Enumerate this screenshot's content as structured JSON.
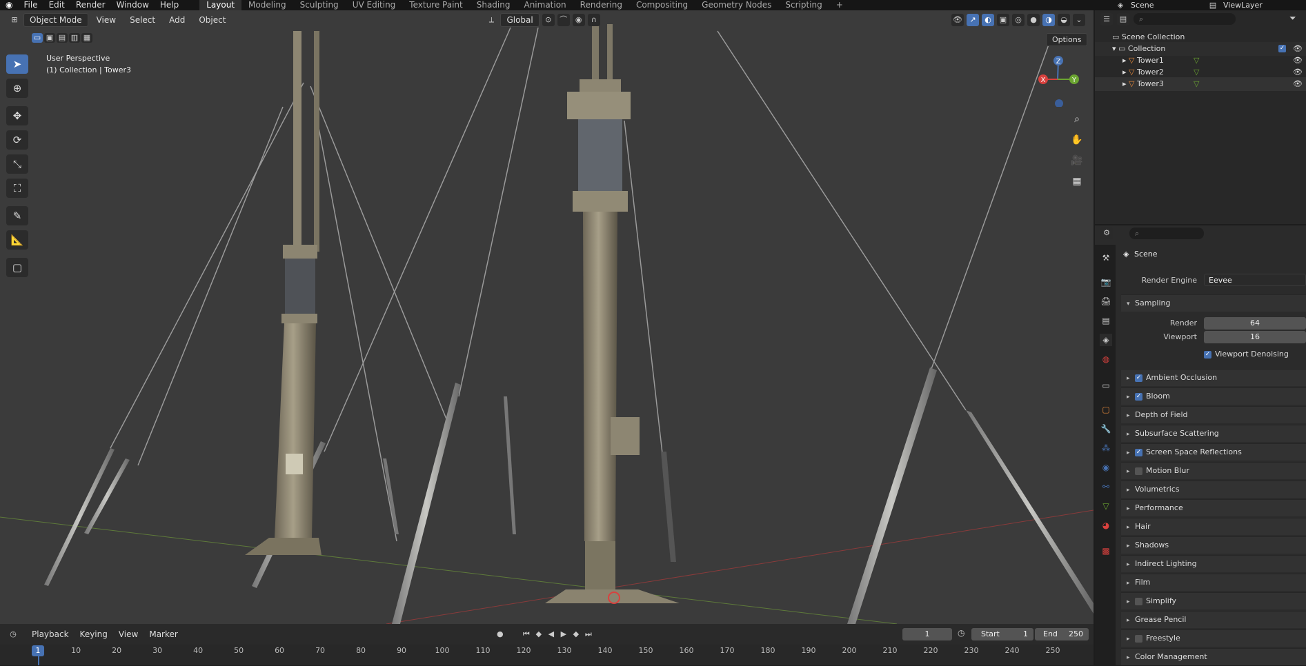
{
  "menu": [
    "File",
    "Edit",
    "Render",
    "Window",
    "Help"
  ],
  "workspaces": [
    "Layout",
    "Modeling",
    "Sculpting",
    "UV Editing",
    "Texture Paint",
    "Shading",
    "Animation",
    "Rendering",
    "Compositing",
    "Geometry Nodes",
    "Scripting"
  ],
  "workspace_add": "+",
  "scene_name": "Scene",
  "view_layer": "ViewLayer",
  "viewport": {
    "mode": "Object Mode",
    "menus": [
      "View",
      "Select",
      "Add",
      "Object"
    ],
    "transform_orientation": "Global",
    "options": "Options",
    "perspective": "User Perspective",
    "collection_info": "(1) Collection | Tower3",
    "gizmo": {
      "x": "X",
      "y": "Y",
      "z": "Z"
    }
  },
  "outliner": {
    "root": "Scene Collection",
    "collection": "Collection",
    "objects": [
      "Tower1",
      "Tower2",
      "Tower3"
    ]
  },
  "properties": {
    "context": "Scene",
    "render_engine_label": "Render Engine",
    "render_engine": "Eevee",
    "sampling": "Sampling",
    "render_label": "Render",
    "render_samples": "64",
    "viewport_label": "Viewport",
    "viewport_samples": "16",
    "viewport_denoising": "Viewport Denoising",
    "panels": [
      {
        "label": "Ambient Occlusion",
        "checkbox": true,
        "checked": true
      },
      {
        "label": "Bloom",
        "checkbox": true,
        "checked": true
      },
      {
        "label": "Depth of Field",
        "checkbox": false,
        "checked": false
      },
      {
        "label": "Subsurface Scattering",
        "checkbox": false,
        "checked": false
      },
      {
        "label": "Screen Space Reflections",
        "checkbox": true,
        "checked": true
      },
      {
        "label": "Motion Blur",
        "checkbox": true,
        "checked": false
      },
      {
        "label": "Volumetrics",
        "checkbox": false,
        "checked": false
      },
      {
        "label": "Performance",
        "checkbox": false,
        "checked": false
      },
      {
        "label": "Hair",
        "checkbox": false,
        "checked": false
      },
      {
        "label": "Shadows",
        "checkbox": false,
        "checked": false
      },
      {
        "label": "Indirect Lighting",
        "checkbox": false,
        "checked": false
      },
      {
        "label": "Film",
        "checkbox": false,
        "checked": false
      },
      {
        "label": "Simplify",
        "checkbox": true,
        "checked": false
      },
      {
        "label": "Grease Pencil",
        "checkbox": false,
        "checked": false
      },
      {
        "label": "Freestyle",
        "checkbox": true,
        "checked": false
      },
      {
        "label": "Color Management",
        "checkbox": false,
        "checked": false
      }
    ]
  },
  "timeline": {
    "menus": [
      "Playback",
      "Keying",
      "View",
      "Marker"
    ],
    "current_frame": "1",
    "start_label": "Start",
    "start": "1",
    "end_label": "End",
    "end": "250",
    "ticks": [
      "1",
      "10",
      "20",
      "30",
      "40",
      "50",
      "60",
      "70",
      "80",
      "90",
      "100",
      "110",
      "120",
      "130",
      "140",
      "150",
      "160",
      "170",
      "180",
      "190",
      "200",
      "210",
      "220",
      "230",
      "240",
      "250"
    ]
  },
  "colors": {
    "accent": "#4772b3",
    "x_axis": "#d9413e",
    "y_axis": "#6ba531",
    "z_axis": "#4772b3"
  }
}
